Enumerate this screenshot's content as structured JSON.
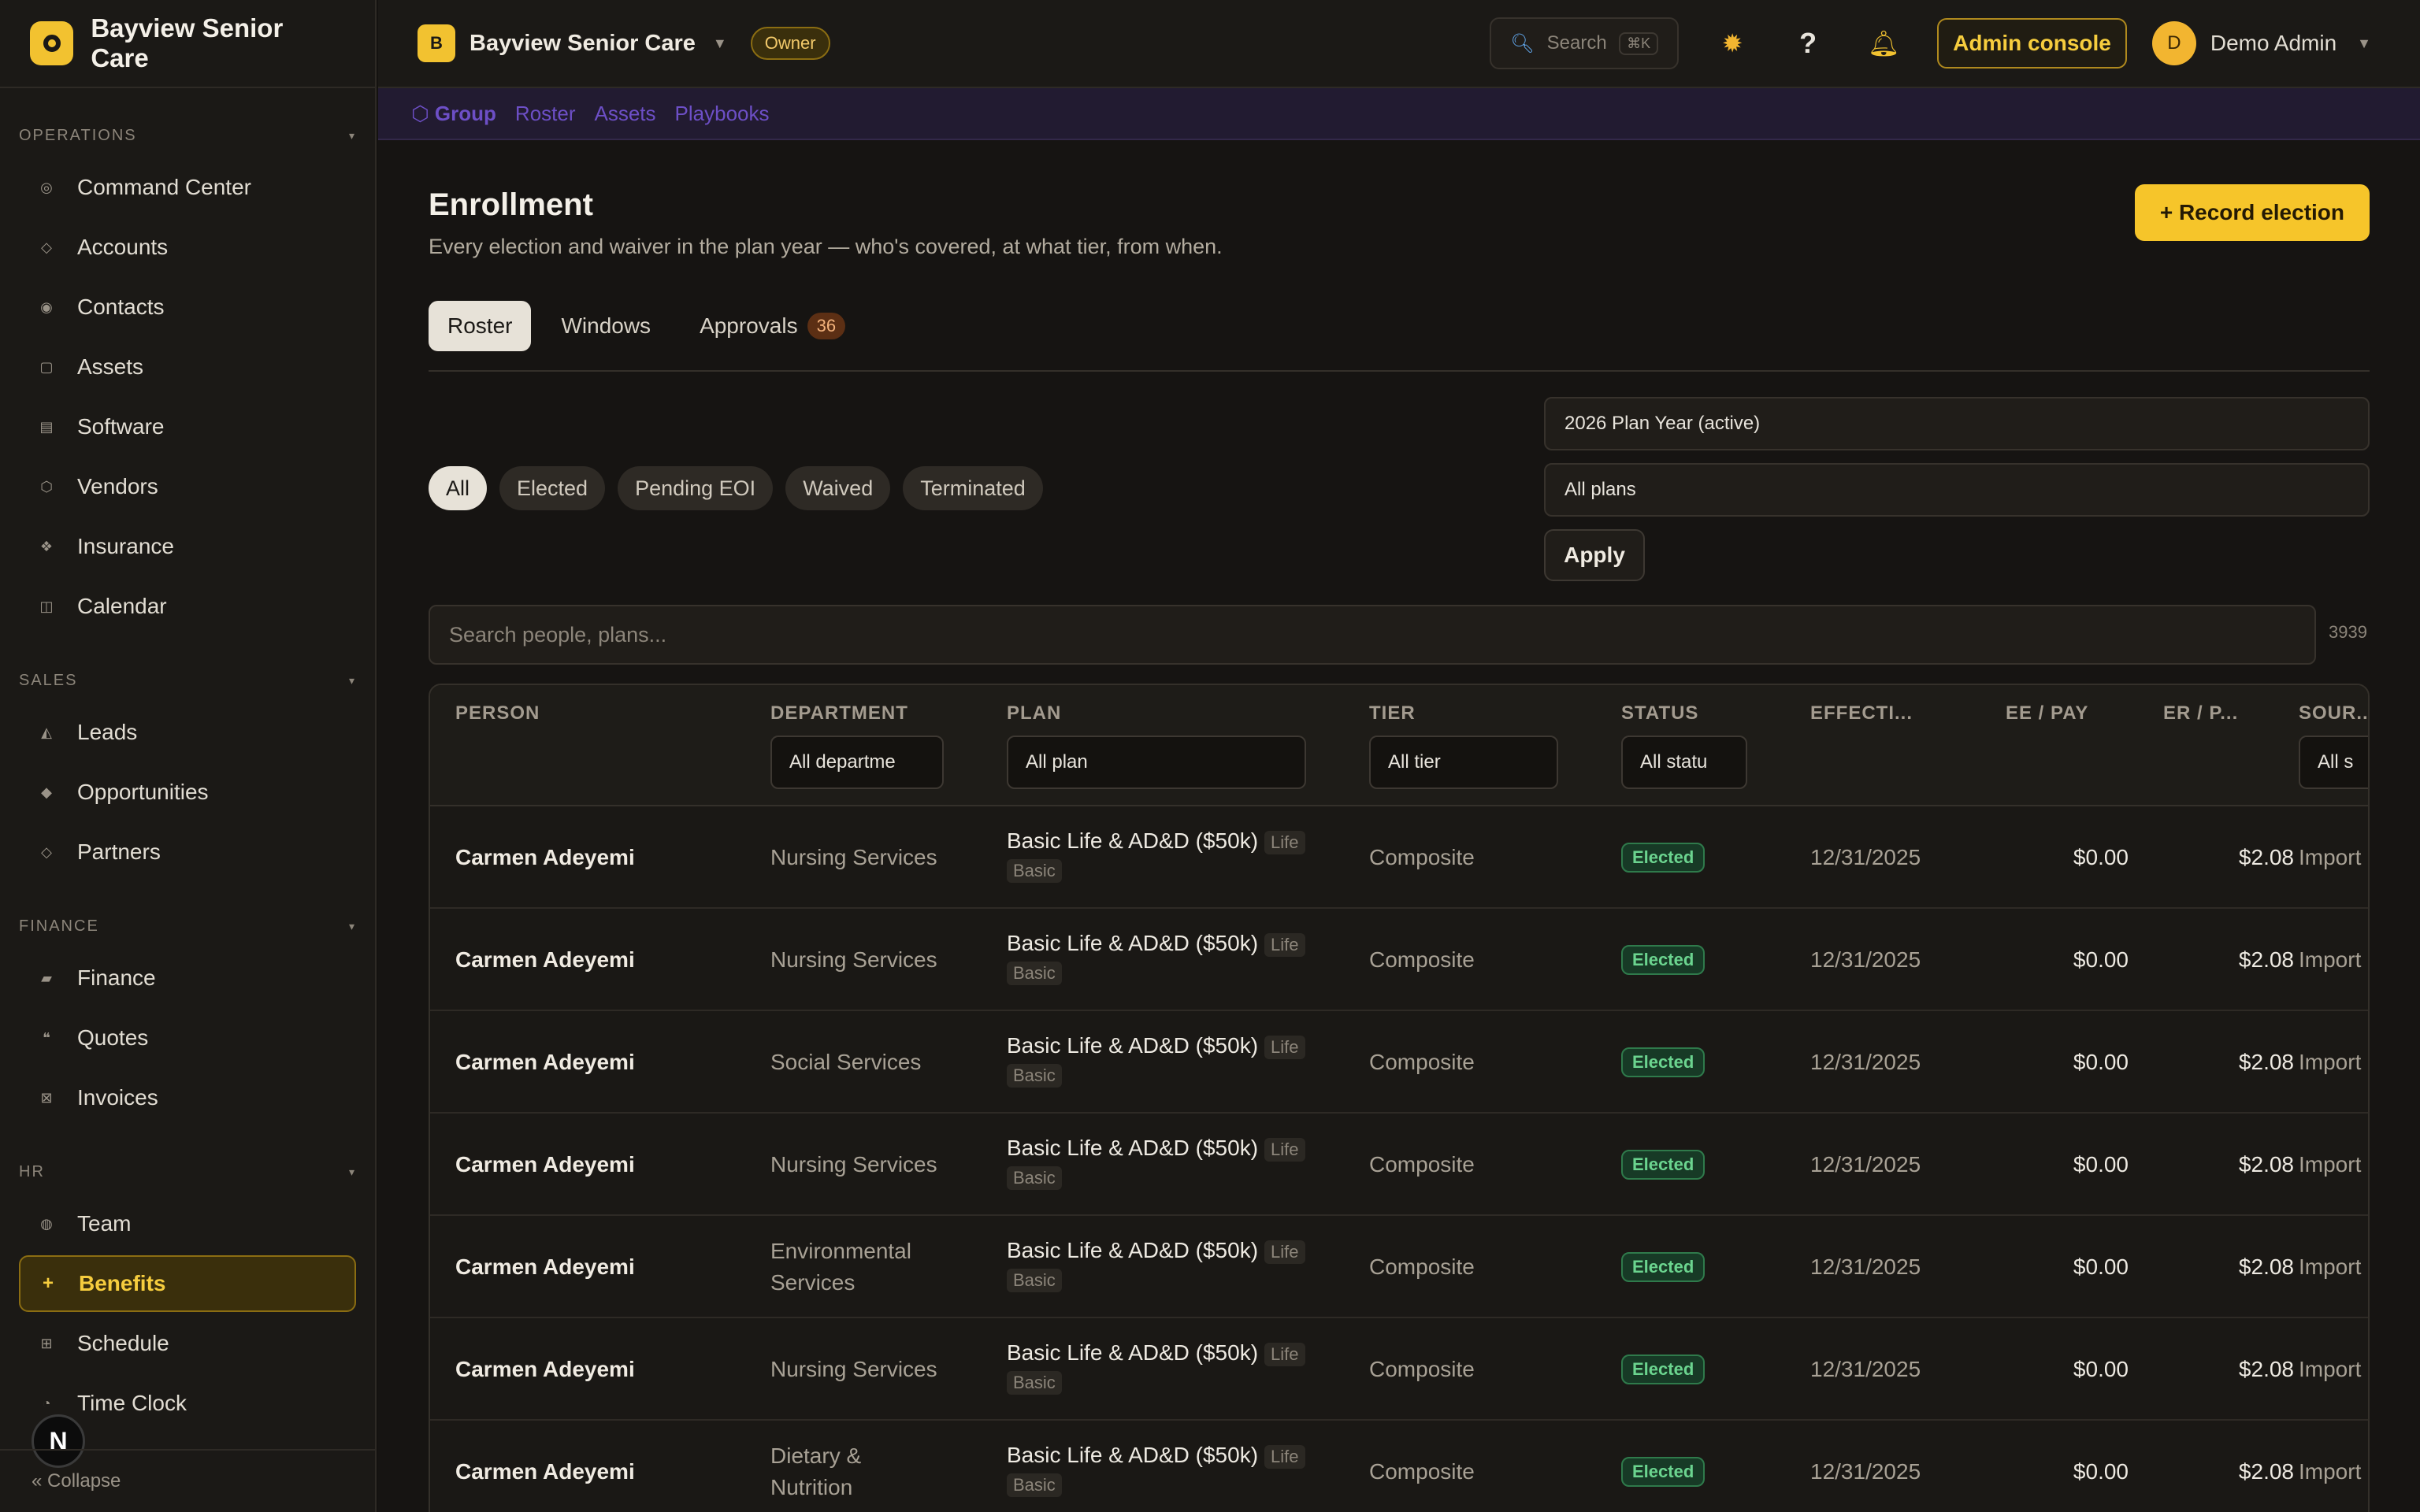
{
  "brand": {
    "name": "Bayview Senior Care"
  },
  "sidebar": {
    "sections": [
      {
        "title": "OPERATIONS",
        "items": [
          {
            "label": "Command Center",
            "icon": "target-icon",
            "glyph": "◎"
          },
          {
            "label": "Accounts",
            "icon": "diamond-icon",
            "glyph": "◇"
          },
          {
            "label": "Contacts",
            "icon": "contact-icon",
            "glyph": "◉"
          },
          {
            "label": "Assets",
            "icon": "box-icon",
            "glyph": "▢"
          },
          {
            "label": "Software",
            "icon": "software-icon",
            "glyph": "▤"
          },
          {
            "label": "Vendors",
            "icon": "hexagon-icon",
            "glyph": "⬡"
          },
          {
            "label": "Insurance",
            "icon": "shield-icon",
            "glyph": "❖"
          },
          {
            "label": "Calendar",
            "icon": "calendar-icon",
            "glyph": "◫"
          }
        ]
      },
      {
        "title": "SALES",
        "items": [
          {
            "label": "Leads",
            "icon": "leads-icon",
            "glyph": "◭"
          },
          {
            "label": "Opportunities",
            "icon": "opportunity-icon",
            "glyph": "◆"
          },
          {
            "label": "Partners",
            "icon": "partners-icon",
            "glyph": "◇"
          }
        ]
      },
      {
        "title": "FINANCE",
        "items": [
          {
            "label": "Finance",
            "icon": "card-icon",
            "glyph": "▰"
          },
          {
            "label": "Quotes",
            "icon": "quote-icon",
            "glyph": "❝"
          },
          {
            "label": "Invoices",
            "icon": "invoice-icon",
            "glyph": "⊠"
          }
        ]
      },
      {
        "title": "HR",
        "items": [
          {
            "label": "Team",
            "icon": "team-icon",
            "glyph": "◍"
          },
          {
            "label": "Benefits",
            "icon": "plus-icon",
            "glyph": "+",
            "active": true
          },
          {
            "label": "Schedule",
            "icon": "grid-icon",
            "glyph": "⊞"
          },
          {
            "label": "Time Clock",
            "icon": "clock-icon",
            "glyph": "◔"
          }
        ]
      }
    ],
    "collapse_label": "« Collapse",
    "n_badge": "N"
  },
  "topbar": {
    "org_initial": "B",
    "org_name": "Bayview Senior Care",
    "owner_label": "Owner",
    "search_label": "Search",
    "search_shortcut": "⌘K",
    "admin_label": "Admin console",
    "user_initial": "D",
    "user_name": "Demo Admin"
  },
  "subnav": {
    "group": "⬡ Group",
    "items": [
      "Roster",
      "Assets",
      "Playbooks"
    ]
  },
  "page": {
    "title": "Enrollment",
    "subtitle": "Every election and waiver in the plan year — who's covered, at what tier, from when.",
    "record_button": "+ Record election"
  },
  "tabs": [
    {
      "label": "Roster",
      "active": true
    },
    {
      "label": "Windows"
    },
    {
      "label": "Approvals",
      "count": "36"
    }
  ],
  "chips": [
    "All",
    "Elected",
    "Pending EOI",
    "Waived",
    "Terminated"
  ],
  "filters": {
    "plan_year": "2026 Plan Year (active)",
    "plans": "All plans",
    "apply_label": "Apply"
  },
  "table_search": {
    "placeholder": "Search people, plans...",
    "count": "3939"
  },
  "table": {
    "headers": {
      "person": "PERSON",
      "department": "DEPARTMENT",
      "plan": "PLAN",
      "tier": "TIER",
      "status": "STATUS",
      "effective": "EFFECTI...",
      "ee": "EE / PAY",
      "er": "ER / P...",
      "source": "SOUR..."
    },
    "header_filters": {
      "department": "All departme",
      "plan": "All plan",
      "tier": "All tier",
      "status": "All statu",
      "source": "All s"
    },
    "rows": [
      {
        "person": "Carmen Adeyemi",
        "department": "Nursing Services",
        "plan": "Basic Life & AD&D ($50k)",
        "plan_type": "Life",
        "plan_level": "Basic",
        "tier": "Composite",
        "status": "Elected",
        "effective": "12/31/2025",
        "ee": "$0.00",
        "er": "$2.08",
        "source": "Import"
      },
      {
        "person": "Carmen Adeyemi",
        "department": "Nursing Services",
        "plan": "Basic Life & AD&D ($50k)",
        "plan_type": "Life",
        "plan_level": "Basic",
        "tier": "Composite",
        "status": "Elected",
        "effective": "12/31/2025",
        "ee": "$0.00",
        "er": "$2.08",
        "source": "Import"
      },
      {
        "person": "Carmen Adeyemi",
        "department": "Social Services",
        "plan": "Basic Life & AD&D ($50k)",
        "plan_type": "Life",
        "plan_level": "Basic",
        "tier": "Composite",
        "status": "Elected",
        "effective": "12/31/2025",
        "ee": "$0.00",
        "er": "$2.08",
        "source": "Import"
      },
      {
        "person": "Carmen Adeyemi",
        "department": "Nursing Services",
        "plan": "Basic Life & AD&D ($50k)",
        "plan_type": "Life",
        "plan_level": "Basic",
        "tier": "Composite",
        "status": "Elected",
        "effective": "12/31/2025",
        "ee": "$0.00",
        "er": "$2.08",
        "source": "Import"
      },
      {
        "person": "Carmen Adeyemi",
        "department": "Environmental Services",
        "plan": "Basic Life & AD&D ($50k)",
        "plan_type": "Life",
        "plan_level": "Basic",
        "tier": "Composite",
        "status": "Elected",
        "effective": "12/31/2025",
        "ee": "$0.00",
        "er": "$2.08",
        "source": "Import"
      },
      {
        "person": "Carmen Adeyemi",
        "department": "Nursing Services",
        "plan": "Basic Life & AD&D ($50k)",
        "plan_type": "Life",
        "plan_level": "Basic",
        "tier": "Composite",
        "status": "Elected",
        "effective": "12/31/2025",
        "ee": "$0.00",
        "er": "$2.08",
        "source": "Import"
      },
      {
        "person": "Carmen Adeyemi",
        "department": "Dietary & Nutrition",
        "plan": "Basic Life & AD&D ($50k)",
        "plan_type": "Life",
        "plan_level": "Basic",
        "tier": "Composite",
        "status": "Elected",
        "effective": "12/31/2025",
        "ee": "$0.00",
        "er": "$2.08",
        "source": "Import"
      }
    ]
  },
  "colors": {
    "accent": "#f6c52a",
    "background": "#141210",
    "status_elected": "#6bd48f",
    "subnav": "#6d4fc6"
  }
}
